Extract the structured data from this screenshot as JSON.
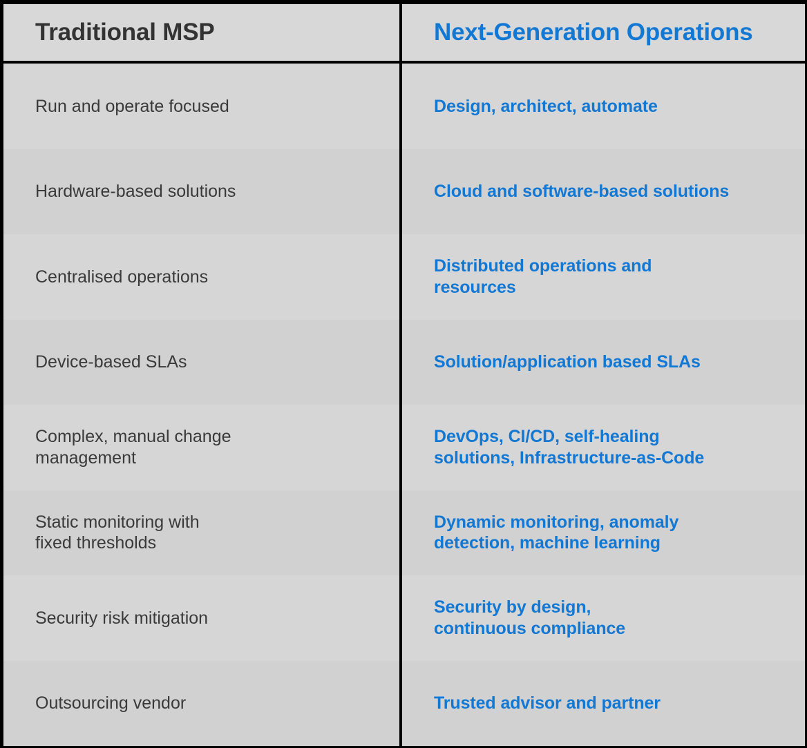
{
  "colors": {
    "accent_blue": "#1278d4",
    "text_dark": "#3a3a3a",
    "header_dark": "#333333",
    "row_shade_a": "#d6d6d6",
    "row_shade_b": "#d1d1d1",
    "frame": "#000000"
  },
  "table": {
    "headers": {
      "left": "Traditional MSP",
      "right": "Next-Generation Operations"
    },
    "rows": [
      {
        "left": "Run and operate focused",
        "right": "Design, architect, automate"
      },
      {
        "left": "Hardware-based solutions",
        "right": "Cloud and software-based solutions"
      },
      {
        "left": "Centralised operations",
        "right": "Distributed operations and\nresources"
      },
      {
        "left": "Device-based SLAs",
        "right": "Solution/application based SLAs"
      },
      {
        "left": "Complex, manual change\nmanagement",
        "right": "DevOps, CI/CD, self-healing\nsolutions, Infrastructure-as-Code"
      },
      {
        "left": "Static monitoring with\nfixed thresholds",
        "right": "Dynamic monitoring, anomaly\ndetection, machine learning"
      },
      {
        "left": "Security risk mitigation",
        "right": "Security by design,\ncontinuous compliance"
      },
      {
        "left": "Outsourcing vendor",
        "right": "Trusted advisor and partner"
      }
    ]
  }
}
